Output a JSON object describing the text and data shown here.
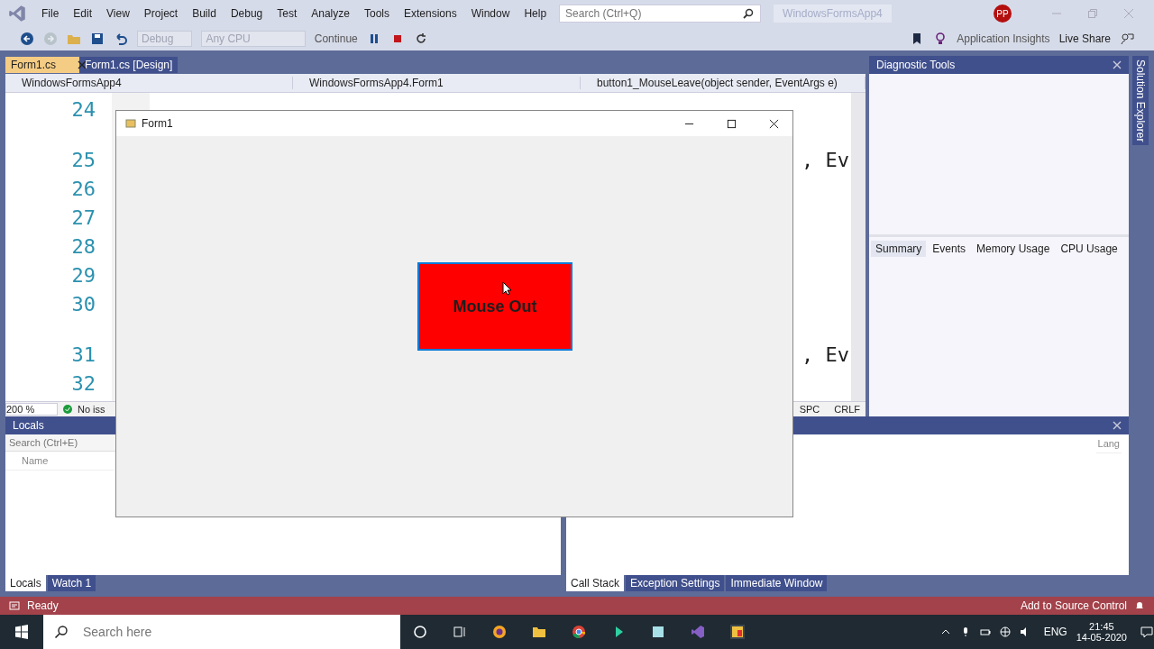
{
  "menu": [
    "File",
    "Edit",
    "View",
    "Project",
    "Build",
    "Debug",
    "Test",
    "Analyze",
    "Tools",
    "Extensions",
    "Window",
    "Help"
  ],
  "search": {
    "placeholder": "Search (Ctrl+Q)"
  },
  "solution_name": "WindowsFormsApp4",
  "avatar": "PP",
  "toolbar": {
    "configuration": {
      "label": "Debug",
      "disabled": true
    },
    "platform": {
      "label": "Any CPU",
      "disabled": true
    },
    "continue": "Continue",
    "insights": "Application Insights",
    "live_share": "Live Share"
  },
  "editor": {
    "tabs": [
      {
        "label": "Form1.cs",
        "selected": true
      },
      {
        "label": "Form1.cs [Design]",
        "selected": false
      }
    ],
    "nav": [
      "WindowsFormsApp4",
      "WindowsFormsApp4.Form1",
      "button1_MouseLeave(object sender, EventArgs e)"
    ],
    "lines": [
      {
        "number": "24"
      },
      {
        "number": "25",
        "code": ", Ev"
      },
      {
        "number": "26"
      },
      {
        "number": "27"
      },
      {
        "number": "28"
      },
      {
        "number": "29"
      },
      {
        "number": "30"
      },
      {
        "number": "31",
        "code": ", Ev"
      },
      {
        "number": "32"
      }
    ],
    "zoom": "200 %",
    "issues": "No iss",
    "whitespace": "SPC",
    "line_ending": "CRLF"
  },
  "form": {
    "title": "Form1",
    "button": "Mouse Out"
  },
  "diagnostic": {
    "title": "Diagnostic Tools",
    "tabs": [
      {
        "label": "Summary",
        "selected": true
      },
      {
        "label": "Events",
        "selected": false
      },
      {
        "label": "Memory Usage",
        "selected": false
      },
      {
        "label": "CPU Usage",
        "selected": false
      }
    ]
  },
  "side_tab": "Solution Explorer",
  "locals": {
    "title": "Locals",
    "search": {
      "placeholder": "Search (Ctrl+E)"
    },
    "column": "Name",
    "tabs": [
      {
        "label": "Locals",
        "selected": true
      },
      {
        "label": "Watch 1",
        "selected": false
      }
    ]
  },
  "callstack": {
    "column": "Lang",
    "tabs": [
      {
        "label": "Call Stack",
        "selected": true
      },
      {
        "label": "Exception Settings",
        "selected": false
      },
      {
        "label": "Immediate Window",
        "selected": false
      }
    ]
  },
  "status_bar": {
    "state": "Ready",
    "source_control": "Add to Source Control"
  },
  "taskbar": {
    "search": {
      "placeholder": "Search here"
    },
    "language": "ENG",
    "time": "21:45",
    "date": "14-05-2020"
  }
}
